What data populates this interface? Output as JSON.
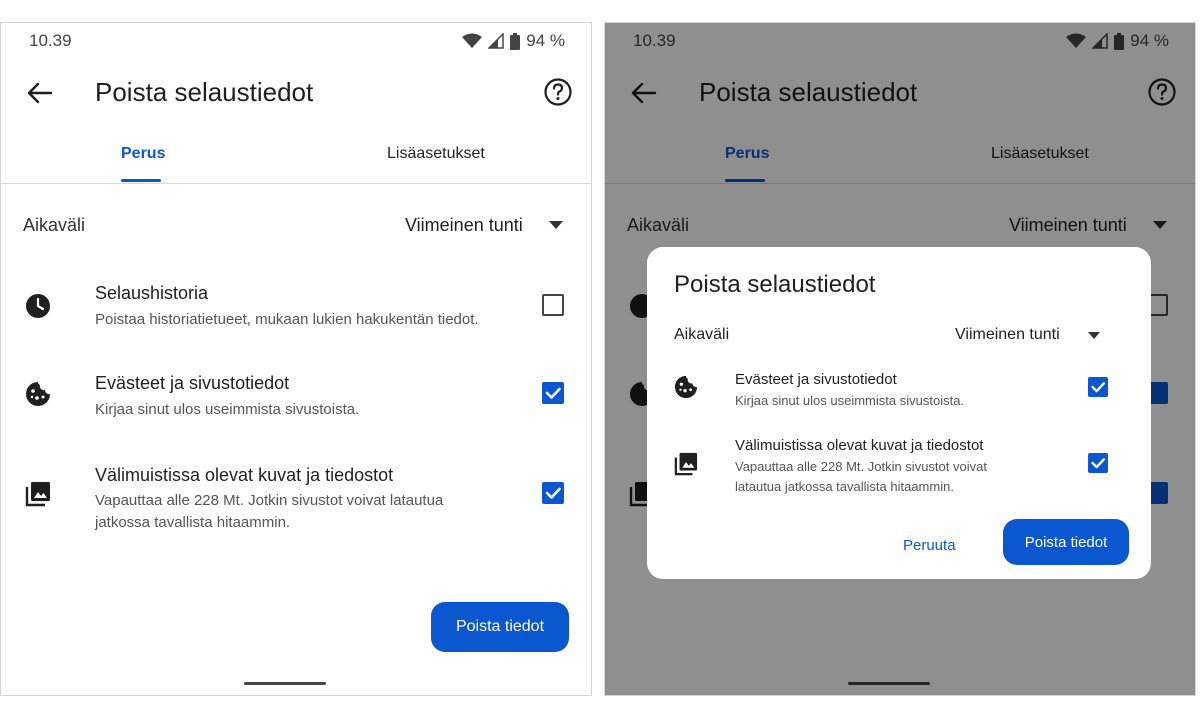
{
  "status": {
    "time": "10.39",
    "battery": "94 %"
  },
  "header": {
    "title": "Poista selaustiedot"
  },
  "tabs": [
    {
      "label": "Perus",
      "selected": true
    },
    {
      "label": "Lisäasetukset",
      "selected": false
    }
  ],
  "time_range": {
    "label": "Aikaväli",
    "value": "Viimeinen tunti"
  },
  "items": [
    {
      "icon": "clock-icon",
      "title": "Selaushistoria",
      "desc": "Poistaa historiatietueet, mukaan lukien hakukentän tiedot.",
      "checked": false
    },
    {
      "icon": "cookie-icon",
      "title": "Evästeet ja sivustotiedot",
      "desc": "Kirjaa sinut ulos useimmista sivustoista.",
      "checked": true
    },
    {
      "icon": "images-icon",
      "title": "Välimuistissa olevat kuvat ja tiedostot",
      "desc": "Vapauttaa alle 228 Mt. Jotkin sivustot voivat latautua jatkossa tavallista hitaammin.",
      "checked": true
    }
  ],
  "primary_button": "Poista tiedot",
  "dialog": {
    "title": "Poista selaustiedot",
    "range_label": "Aikaväli",
    "range_value": "Viimeinen tunti",
    "items": [
      {
        "icon": "cookie-icon",
        "title": "Evästeet ja sivustotiedot",
        "desc": "Kirjaa sinut ulos useimmista sivustoista.",
        "checked": true
      },
      {
        "icon": "images-icon",
        "title": "Välimuistissa olevat kuvat ja tiedostot",
        "desc": "Vapauttaa alle 228 Mt. Jotkin sivustot voivat latautua jatkossa tavallista hitaammin.",
        "checked": true
      }
    ],
    "cancel_label": "Peruuta",
    "confirm_label": "Poista tiedot"
  },
  "colors": {
    "accent": "#0b57d0",
    "scrim": "#000000"
  }
}
